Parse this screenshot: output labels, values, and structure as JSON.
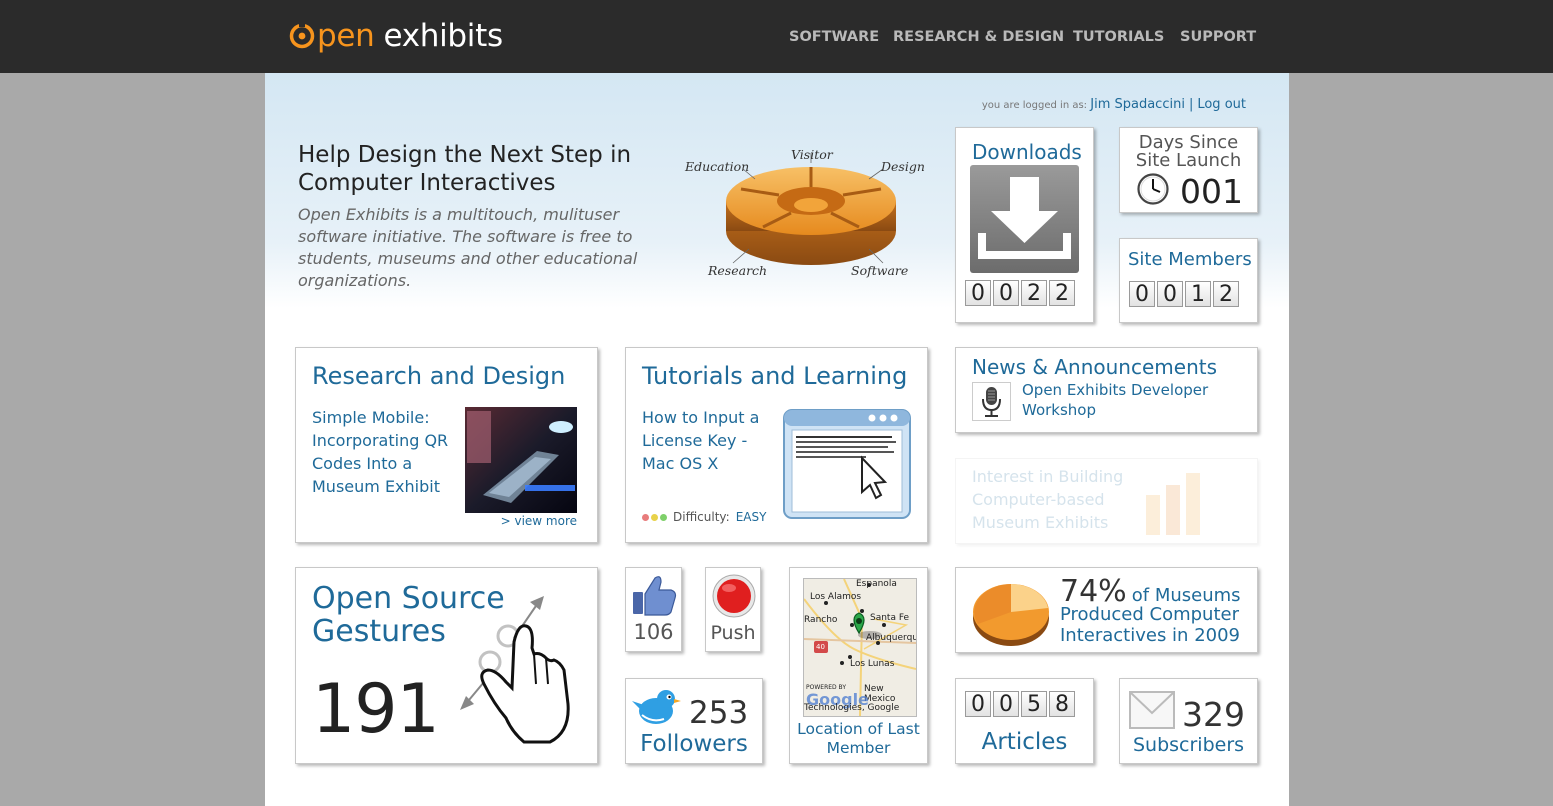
{
  "brand": {
    "open": "pen",
    "exhibits": "exhibits"
  },
  "nav": [
    "SOFTWARE",
    "RESEARCH & DESIGN",
    "TUTORIALS",
    "SUPPORT"
  ],
  "login": {
    "prefix": "you are logged in as:",
    "user": "Jim Spadaccini",
    "sep": "|",
    "logout": "Log out"
  },
  "intro": {
    "title": "Help Design the Next Step in Computer Interactives",
    "text": "Open Exhibits is a multitouch, mulituser software initiative. The software is free to students, museums and other educational organizations."
  },
  "diagram": {
    "labels": [
      "Education",
      "Visitor",
      "Design",
      "Research",
      "Software"
    ]
  },
  "downloads": {
    "title": "Downloads",
    "digits": [
      "0",
      "0",
      "2",
      "2"
    ]
  },
  "days": {
    "title_line1": "Days Since",
    "title_line2": "Site Launch",
    "value": "001"
  },
  "members": {
    "title": "Site Members",
    "digits": [
      "0",
      "0",
      "1",
      "2"
    ]
  },
  "research": {
    "title": "Research and Design",
    "link": "Simple Mobile: Incorporating QR Codes Into a Museum Exhibit",
    "more": "> view more"
  },
  "tutorials": {
    "title": "Tutorials and Learning",
    "link": "How to Input a License Key - Mac OS X",
    "difficulty_label": "Difficulty:",
    "difficulty": "EASY"
  },
  "news": {
    "title": "News & Announcements",
    "item": "Open Exhibits Developer Workshop"
  },
  "interest": {
    "text": "Interest in Building Computer-based Museum Exhibits"
  },
  "gestures": {
    "title": "Open Source Gestures",
    "count": "191"
  },
  "likes": {
    "count": "106"
  },
  "push": {
    "label": "Push"
  },
  "map": {
    "caption": "Location of Last Member",
    "places": [
      "Espanola",
      "Los Alamos",
      "Rancho",
      "Santa Fe",
      "Albuquerque",
      "Los Lunas",
      "New Mexico",
      "40"
    ],
    "powered": "POWERED BY",
    "google": "Google",
    "credit": "Technologies, Google"
  },
  "museums": {
    "percent": "74%",
    "text1": "of Museums",
    "text2": "Produced Computer",
    "text3": "Interactives in 2009"
  },
  "twitter": {
    "count": "253",
    "label": "Followers"
  },
  "articles": {
    "digits": [
      "0",
      "0",
      "5",
      "8"
    ],
    "label": "Articles"
  },
  "subscribers": {
    "count": "329",
    "label": "Subscribers"
  },
  "colors": {
    "brand_orange": "#f7941d",
    "link_blue": "#1f6a99",
    "header_bg": "#2b2b2b",
    "page_bg": "#a9a9a9"
  }
}
